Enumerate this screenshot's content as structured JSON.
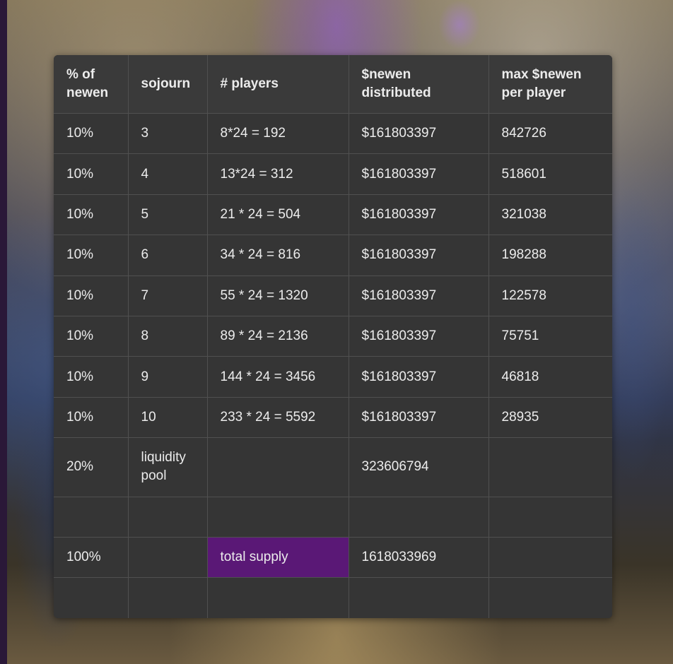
{
  "table": {
    "headers": [
      "% of newen",
      "sojourn",
      "# players",
      "$newen distributed",
      "max $newen per player"
    ],
    "rows": [
      [
        "10%",
        "3",
        "8*24 = 192",
        "$161803397",
        "842726"
      ],
      [
        "10%",
        "4",
        "13*24 = 312",
        "$161803397",
        "518601"
      ],
      [
        "10%",
        "5",
        "21 * 24 = 504",
        "$161803397",
        "321038"
      ],
      [
        "10%",
        "6",
        "34 * 24 = 816",
        "$161803397",
        "198288"
      ],
      [
        "10%",
        "7",
        "55 * 24 = 1320",
        "$161803397",
        "122578"
      ],
      [
        "10%",
        "8",
        "89 * 24 = 2136",
        "$161803397",
        "75751"
      ],
      [
        "10%",
        "9",
        "144 * 24 = 3456",
        "$161803397",
        "46818"
      ],
      [
        "10%",
        "10",
        "233 * 24 = 5592",
        "$161803397",
        "28935"
      ],
      [
        "20%",
        "liquidity pool",
        "",
        "323606794",
        ""
      ],
      [
        "",
        "",
        "",
        "",
        ""
      ],
      [
        "100%",
        "",
        "total supply",
        "1618033969",
        ""
      ],
      [
        "",
        "",
        "",
        "",
        ""
      ]
    ],
    "highlight_color": "#5a1876"
  }
}
